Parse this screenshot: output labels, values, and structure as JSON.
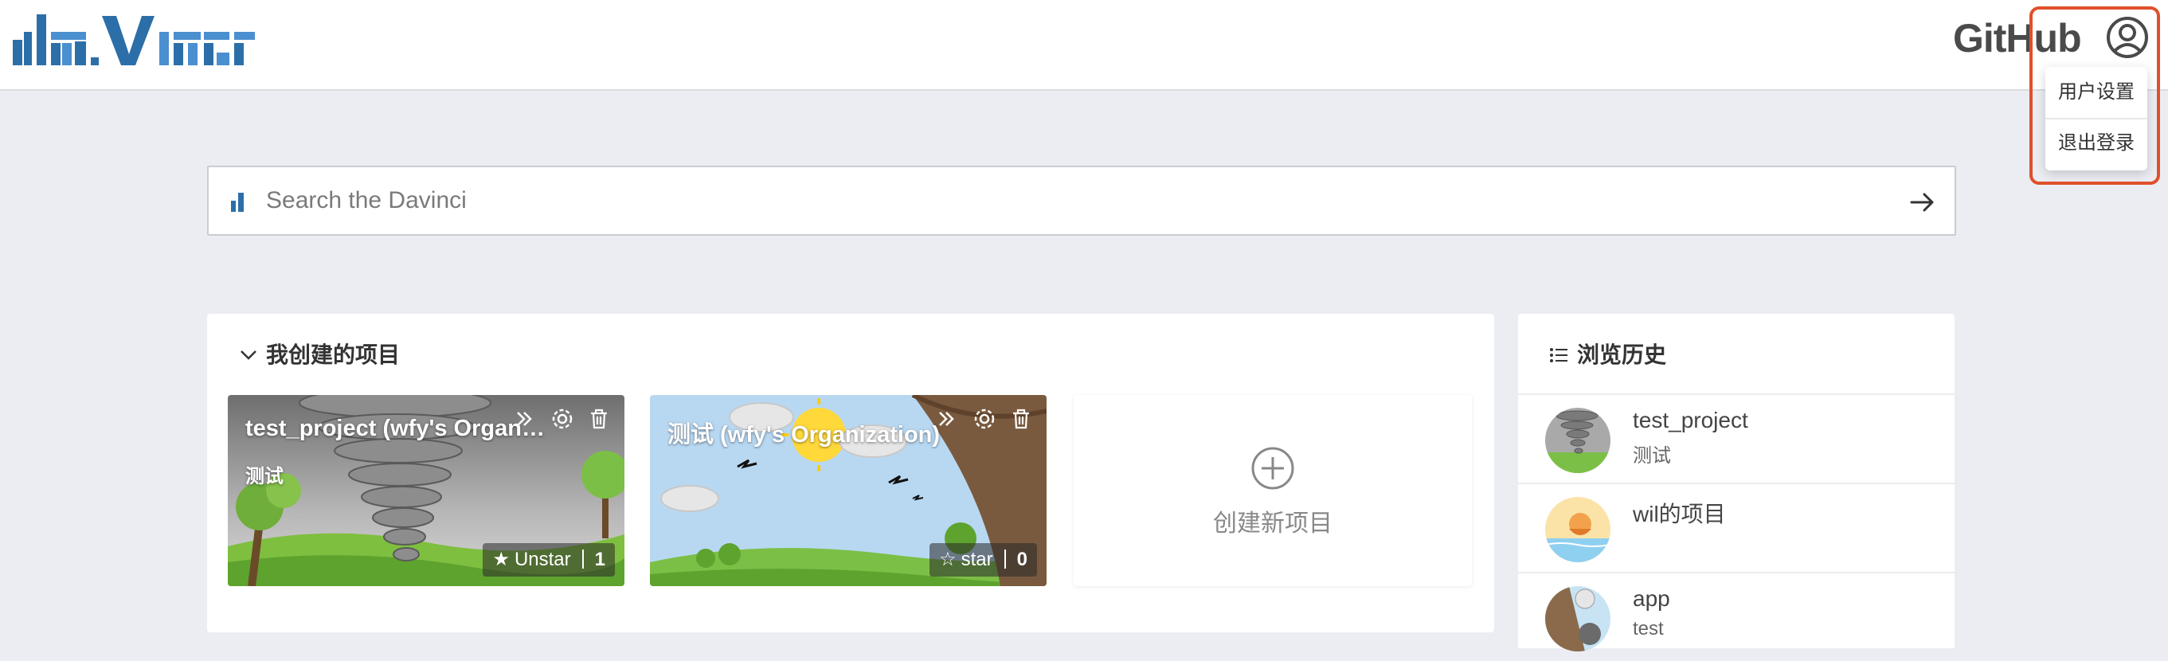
{
  "header": {
    "logo_text": "davinci",
    "github_label": "GitHub",
    "user_menu": {
      "items": [
        {
          "label": "用户设置"
        },
        {
          "label": "退出登录"
        }
      ]
    }
  },
  "search": {
    "placeholder": "Search the Davinci",
    "value": ""
  },
  "projects": {
    "section_title": "我创建的项目",
    "cards": [
      {
        "title": "test_project (wfy's Organiz...",
        "description": "测试",
        "star_label": "Unstar",
        "star_icon": "star-filled-icon",
        "star_count": "1"
      },
      {
        "title": "测试 (wfy's Organization)",
        "description": "",
        "star_label": "star",
        "star_icon": "star-outline-icon",
        "star_count": "0"
      }
    ],
    "create_label": "创建新项目"
  },
  "history": {
    "title": "浏览历史",
    "items": [
      {
        "name": "test_project",
        "description": "测试"
      },
      {
        "name": "wil的项目",
        "description": ""
      },
      {
        "name": "app",
        "description": "test"
      }
    ]
  },
  "colors": {
    "brand_blue": "#2c6fa8",
    "highlight": "#e0502a",
    "page_bg": "#ebedf2"
  }
}
